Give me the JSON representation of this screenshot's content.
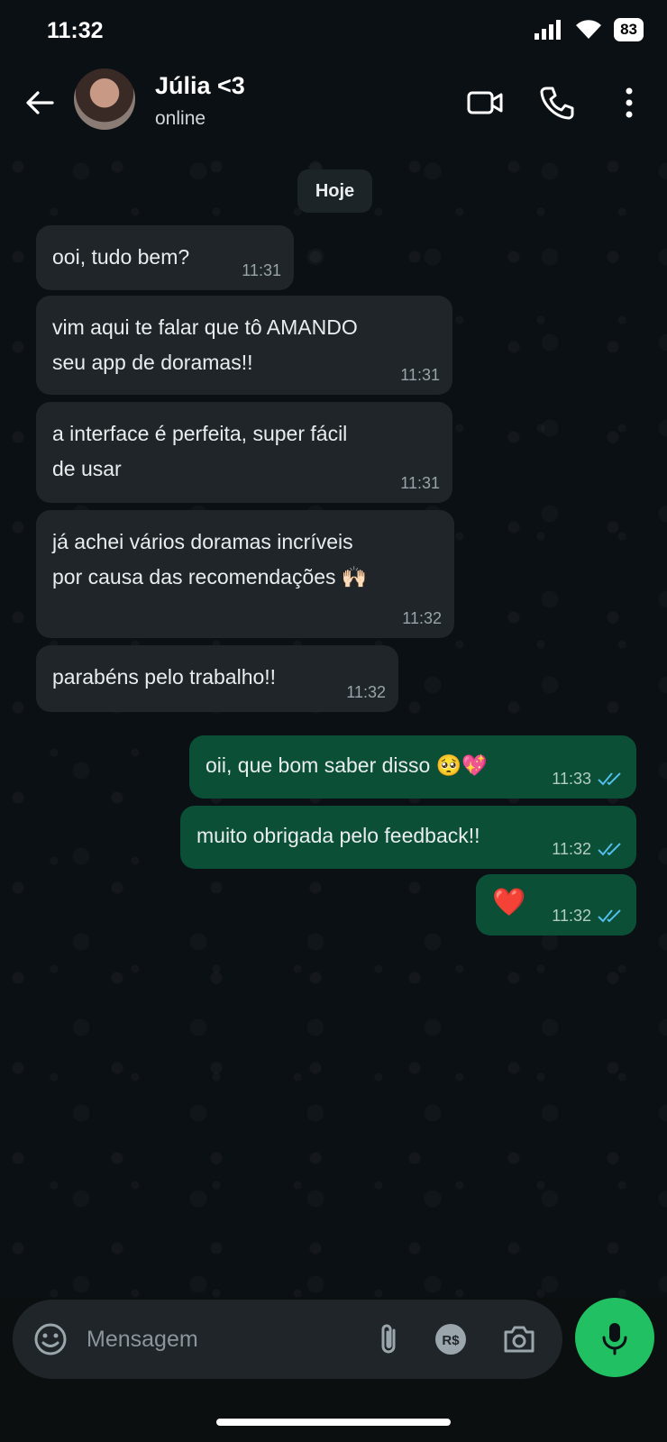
{
  "status": {
    "time": "11:32",
    "battery": "83"
  },
  "header": {
    "name": "Júlia <3",
    "presence": "online"
  },
  "date_chip": "Hoje",
  "messages": [
    {
      "dir": "in",
      "lines": [
        "ooi, tudo bem?"
      ],
      "time": "11:31"
    },
    {
      "dir": "in",
      "lines": [
        "vim aqui te falar que tô AMANDO",
        "seu app de doramas!!"
      ],
      "time": "11:31"
    },
    {
      "dir": "in",
      "lines": [
        "a interface é perfeita, super fácil",
        "de usar"
      ],
      "time": "11:31"
    },
    {
      "dir": "in",
      "lines": [
        "já achei vários doramas incríveis",
        "por causa das recomendações 🙌🏻"
      ],
      "time": "11:32"
    },
    {
      "dir": "in",
      "lines": [
        "parabéns pelo trabalho!!"
      ],
      "time": "11:32"
    },
    {
      "dir": "out",
      "lines": [
        "oii, que bom saber disso 🥺💖"
      ],
      "time": "11:33",
      "read": true
    },
    {
      "dir": "out",
      "lines": [
        "muito obrigada pelo feedback!!"
      ],
      "time": "11:32",
      "read": true
    },
    {
      "dir": "out",
      "lines": [
        "❤️"
      ],
      "time": "11:32",
      "read": true
    }
  ],
  "composer": {
    "placeholder": "Mensagem"
  },
  "icons": {
    "back": "arrow-left-icon",
    "video": "video-call-icon",
    "call": "phone-icon",
    "menu": "more-vert-icon",
    "emoji": "emoji-icon",
    "attach": "paperclip-icon",
    "payment": "pix-payment-icon",
    "camera": "camera-icon",
    "mic": "mic-icon"
  },
  "colors": {
    "incoming_bubble": "#1f2528",
    "outgoing_bubble": "#0a4f36",
    "accent": "#21c063",
    "read_ticks": "#53bdeb"
  }
}
